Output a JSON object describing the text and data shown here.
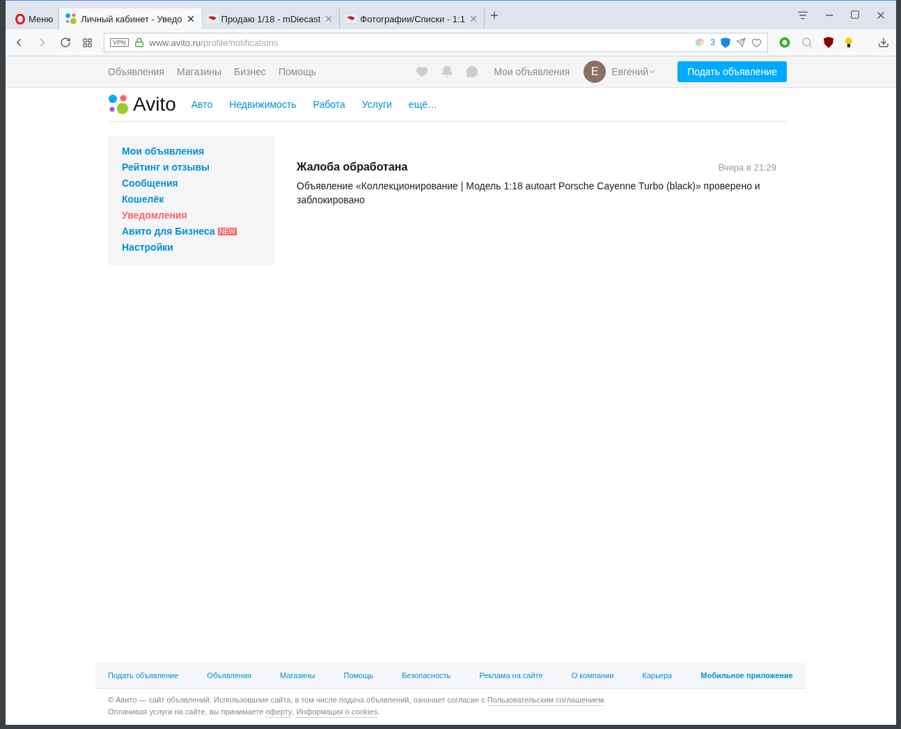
{
  "browser": {
    "tabs": [
      {
        "kind": "menu",
        "label": "Меню",
        "selected": false
      },
      {
        "kind": "page",
        "label": "Личный кабинет - Уведо",
        "selected": true
      },
      {
        "kind": "page",
        "label": "Продаю 1/18 - mDiecast",
        "selected": false
      },
      {
        "kind": "page",
        "label": "Фотографии/Списки - 1:1",
        "selected": false
      }
    ],
    "address": {
      "vpn": "VPN",
      "host": "www.avito.ru",
      "path": "/profile/notifications",
      "blocked_count": "3"
    }
  },
  "site": {
    "top_nav": [
      "Объявления",
      "Магазины",
      "Бизнес",
      "Помощь"
    ],
    "my_ads": "Мои объявления",
    "user": {
      "initial": "E",
      "name": "Евгений"
    },
    "post_button": "Подать объявление",
    "logo": "Avito",
    "categories": [
      "Авто",
      "Недвижимость",
      "Работа",
      "Услуги",
      "ещё…"
    ],
    "sidebar": [
      {
        "label": "Мои объявления",
        "selected": false
      },
      {
        "label": "Рейтинг и отзывы",
        "selected": false
      },
      {
        "label": "Сообщения",
        "selected": false
      },
      {
        "label": "Кошелёк",
        "selected": false
      },
      {
        "label": "Уведомления",
        "selected": true
      },
      {
        "label": "Авито для Бизнеса",
        "selected": false,
        "badge": "NEW"
      },
      {
        "label": "Настройки",
        "selected": false
      }
    ],
    "notifications": [
      {
        "title": "Жалоба обработана",
        "time": "Вчера в 21:29",
        "text": "Объявление «Коллекционирование | Модель 1:18 autoart Porsche Cayenne Turbo (black)» проверено и заблокировано"
      }
    ],
    "footer_links": [
      {
        "label": "Подать объявление",
        "bold": false
      },
      {
        "label": "Объявления",
        "bold": false
      },
      {
        "label": "Магазины",
        "bold": false
      },
      {
        "label": "Помощь",
        "bold": false
      },
      {
        "label": "Безопасность",
        "bold": false
      },
      {
        "label": "Реклама на сайте",
        "bold": false
      },
      {
        "label": "О компании",
        "bold": false
      },
      {
        "label": "Карьера",
        "bold": false
      },
      {
        "label": "Мобильное приложение",
        "bold": true
      }
    ],
    "legal": [
      [
        {
          "kind": "text",
          "text": "© Авито — сайт объявлений. Использование сайта, в том числе подача объявлений, означает согласие с"
        },
        {
          "kind": "link",
          "text": "Пользовательским соглашением"
        },
        {
          "kind": "text",
          "text": "."
        }
      ],
      [
        {
          "kind": "text",
          "text": "Оплачивая услуги на сайте, вы принимаете"
        },
        {
          "kind": "link",
          "text": "оферту"
        },
        {
          "kind": "text",
          "text": "."
        },
        {
          "kind": "link",
          "text": "Информация о cookies"
        },
        {
          "kind": "text",
          "text": "."
        }
      ]
    ]
  }
}
